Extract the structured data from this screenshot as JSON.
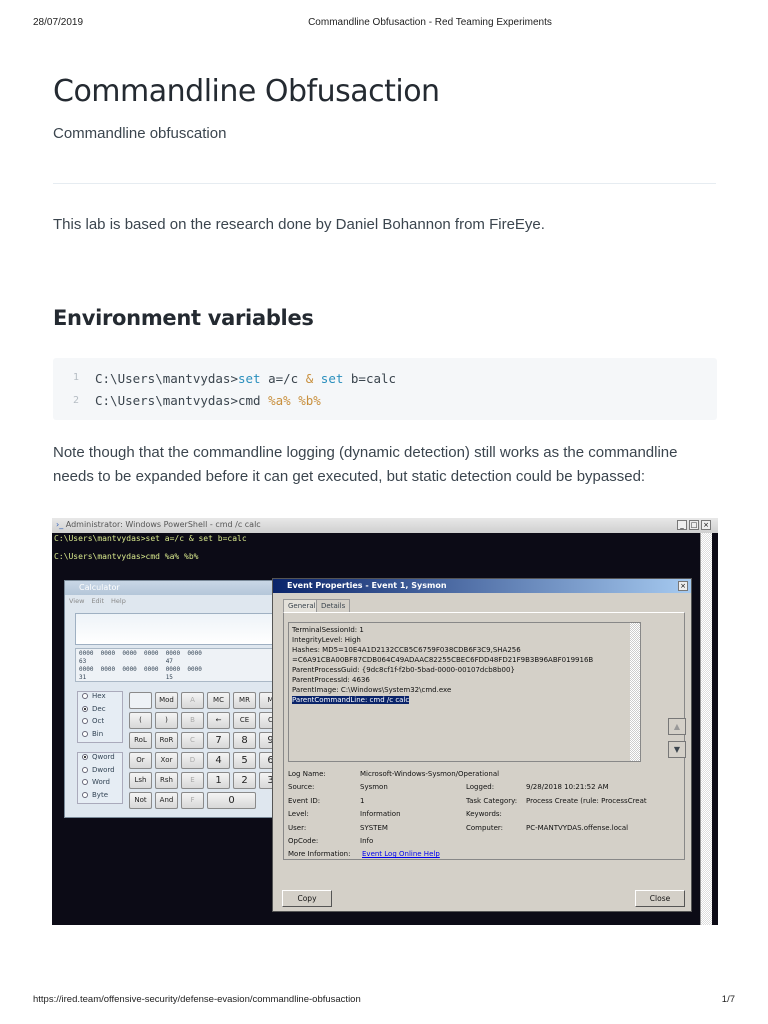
{
  "print_header": {
    "date": "28/07/2019",
    "title": "Commandline Obfusaction - Red Teaming Experiments"
  },
  "page": {
    "title": "Commandline Obfusaction",
    "subtitle": "Commandline obfuscation",
    "intro": "This lab is based on the research done by Daniel Bohannon from FireEye.",
    "section_heading": "Environment variables",
    "code": {
      "line_numbers": [
        "1",
        "2"
      ],
      "line1": {
        "prompt": "C:\\Users\\mantvydas>",
        "kw1": "set",
        "t1": " a=/c ",
        "op": "&",
        "t2": " ",
        "kw2": "set",
        "t3": " b=calc"
      },
      "line2": {
        "prompt": "C:\\Users\\mantvydas>cmd ",
        "v1": "%a%",
        "sp": " ",
        "v2": "%b%"
      }
    },
    "note": "Note though that the commandline logging (dynamic detection) still works as the commandline needs to be expanded before it can get executed, but static detection could be bypassed:"
  },
  "screenshot": {
    "powershell_title": "Administrator: Windows PowerShell - cmd  /c calc",
    "console_lines": [
      "C:\\Users\\mantvydas>set a=/c & set b=calc",
      "C:\\Users\\mantvydas>cmd %a% %b%"
    ],
    "calculator": {
      "title": "Calculator",
      "menu": [
        "View",
        "Edit",
        "Help"
      ],
      "bits": "0000  0000  0000  0000  0000  0000\n63                      47\n0000  0000  0000  0000  0000  0000\n31                      15",
      "base_options": [
        "Hex",
        "Dec",
        "Oct",
        "Bin"
      ],
      "word_options": [
        "Qword",
        "Dword",
        "Word",
        "Byte"
      ],
      "buttons": [
        [
          "",
          "Mod",
          "A",
          "MC",
          "MR",
          "M"
        ],
        [
          "(",
          ")",
          "B",
          "←",
          "CE",
          "C"
        ],
        [
          "RoL",
          "RoR",
          "C",
          "7",
          "8",
          "9"
        ],
        [
          "Or",
          "Xor",
          "D",
          "4",
          "5",
          "6"
        ],
        [
          "Lsh",
          "Rsh",
          "E",
          "1",
          "2",
          "3"
        ],
        [
          "Not",
          "And",
          "F",
          "0",
          "",
          ""
        ]
      ]
    },
    "event_dialog": {
      "title": "Event Properties - Event 1, Sysmon",
      "tabs": [
        "General",
        "Details"
      ],
      "details_lines": [
        "TerminalSessionId: 1",
        "IntegrityLevel: High",
        "Hashes: MD5=10E4A1D2132CCB5C6759F038CDB6F3C9,SHA256",
        "=C6A91CBA00BF87CDB064C49ADAAC82255CBEC6FDD48FD21F9B3B96ABF019916B",
        "ParentProcessGuid: {9dc8cf1f-f2b0-5bad-0000-00107dcb8b00}",
        "ParentProcessId: 4636",
        "ParentImage: C:\\Windows\\System32\\cmd.exe"
      ],
      "selected_line": "ParentCommandLine: cmd  /c  calc",
      "fields": {
        "log_name_label": "Log Name:",
        "log_name": "Microsoft-Windows-Sysmon/Operational",
        "source_label": "Source:",
        "source": "Sysmon",
        "logged_label": "Logged:",
        "logged": "9/28/2018 10:21:52 AM",
        "event_id_label": "Event ID:",
        "event_id": "1",
        "task_category_label": "Task Category:",
        "task_category": "Process Create (rule: ProcessCreat",
        "level_label": "Level:",
        "level": "Information",
        "keywords_label": "Keywords:",
        "user_label": "User:",
        "user": "SYSTEM",
        "computer_label": "Computer:",
        "computer": "PC-MANTVYDAS.offense.local",
        "opcode_label": "OpCode:",
        "opcode": "Info",
        "more_info_label": "More Information:",
        "more_info_link": "Event Log Online Help"
      },
      "copy_button": "Copy",
      "close_button": "Close"
    }
  },
  "footer": {
    "url": "https://ired.team/offensive-security/defense-evasion/commandline-obfusaction",
    "page": "1/7"
  }
}
